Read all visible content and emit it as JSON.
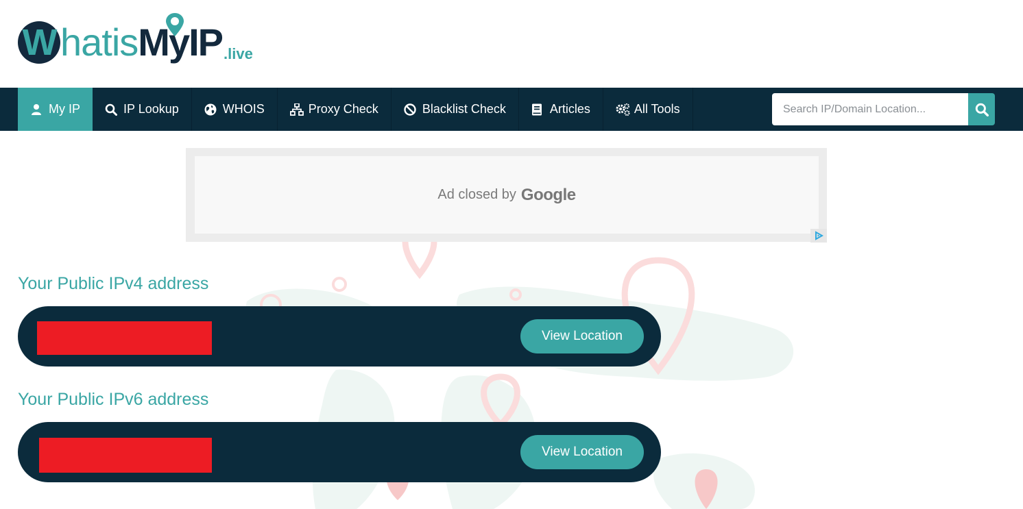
{
  "logo": {
    "letter": "W",
    "text_hatis": "hatis",
    "text_myip": "MyIP",
    "text_live": ".live"
  },
  "nav": {
    "items": [
      {
        "label": "My IP",
        "icon": "user-icon",
        "active": true
      },
      {
        "label": "IP Lookup",
        "icon": "search-icon",
        "active": false
      },
      {
        "label": "WHOIS",
        "icon": "globe-icon",
        "active": false
      },
      {
        "label": "Proxy Check",
        "icon": "network-icon",
        "active": false
      },
      {
        "label": "Blacklist Check",
        "icon": "ban-icon",
        "active": false
      },
      {
        "label": "Articles",
        "icon": "book-icon",
        "active": false
      },
      {
        "label": "All Tools",
        "icon": "cogs-icon",
        "active": false
      }
    ]
  },
  "search": {
    "placeholder": "Search IP/Domain Location..."
  },
  "ad": {
    "text": "Ad closed by",
    "brand": "Google"
  },
  "ipv4": {
    "title": "Your Public IPv4 address",
    "value": "",
    "button": "View Location"
  },
  "ipv6": {
    "title": "Your Public IPv6 address",
    "value": "",
    "button": "View Location"
  },
  "colors": {
    "brand_dark": "#0b2b3c",
    "brand_teal": "#3aa6a4",
    "redaction": "#ed1c24"
  }
}
